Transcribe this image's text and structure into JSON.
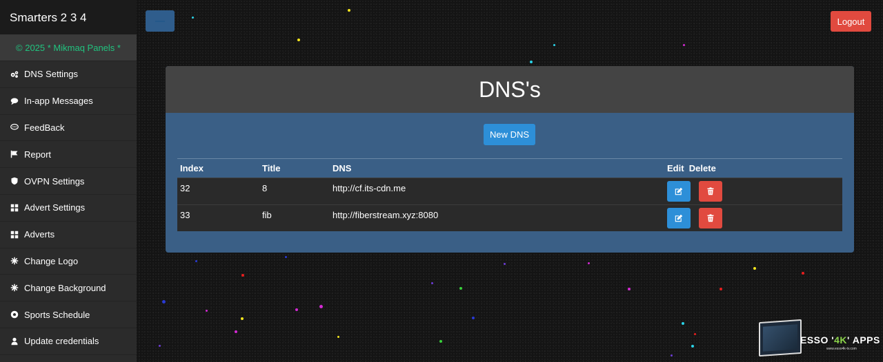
{
  "app": {
    "brand": "Smarters 2 3 4",
    "copyright": "© 2025 * Mikmaq Panels *"
  },
  "sidebar": {
    "items": [
      {
        "label": "DNS Settings",
        "icon": "cogs-icon"
      },
      {
        "label": "In-app Messages",
        "icon": "comment-icon"
      },
      {
        "label": "FeedBack",
        "icon": "comment-dots-icon"
      },
      {
        "label": "Report",
        "icon": "flag-icon"
      },
      {
        "label": "OVPN Settings",
        "icon": "shield-icon"
      },
      {
        "label": "Advert Settings",
        "icon": "th-large-icon"
      },
      {
        "label": "Adverts",
        "icon": "th-large-icon"
      },
      {
        "label": "Change Logo",
        "icon": "snowflake-icon"
      },
      {
        "label": "Change Background",
        "icon": "snowflake-icon"
      },
      {
        "label": "Sports Schedule",
        "icon": "soccer-ball-icon"
      },
      {
        "label": "Update credentials",
        "icon": "user-icon"
      }
    ]
  },
  "header": {
    "menu_icon": "hamburger-icon",
    "logout_label": "Logout"
  },
  "panel": {
    "title": "DNS's",
    "new_button_label": "New DNS",
    "columns": {
      "index": "Index",
      "title": "Title",
      "dns": "DNS",
      "actions": "Edit  Delete"
    },
    "rows": [
      {
        "index": "32",
        "title": "8",
        "dns": "http://cf.its-cdn.me"
      },
      {
        "index": "33",
        "title": "fib",
        "dns": "http://fiberstream.xyz:8080"
      }
    ]
  },
  "watermark": {
    "prefix": "ESSO '",
    "accent": "4K",
    "suffix": "' APPS",
    "url": "www.esso4k-tv.com"
  },
  "colors": {
    "accent_blue": "#2d8fd8",
    "danger_red": "#e14a3f",
    "copyright_green": "#21c37f",
    "panel_blue": "#3a5f86"
  }
}
